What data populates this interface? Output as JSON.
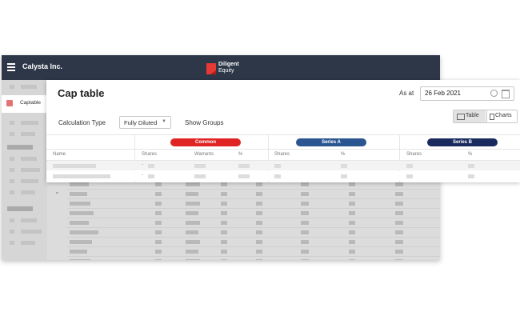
{
  "app": {
    "company": "Calysta Inc.",
    "brand_name": "Diligent",
    "brand_sub": "Equity",
    "brand_color": "#e53935",
    "titlebar_color": "#2d3748"
  },
  "sidebar": {
    "active_item": {
      "label": "Captable",
      "icon": "captable-icon"
    }
  },
  "page": {
    "title": "Cap table",
    "as_at_label": "As at",
    "as_at_date": "26 Feb 2021",
    "calc_type_label": "Calculation Type",
    "calc_type_value": "Fully Diluted",
    "show_groups_label": "Show Groups",
    "view_toggle": {
      "table": "Table",
      "charts": "Charts",
      "selected": "Table"
    }
  },
  "table": {
    "name_header": "Name",
    "groups": [
      {
        "label": "Common",
        "color": "#e02424",
        "columns": [
          "Shares",
          "Warrants",
          "%"
        ]
      },
      {
        "label": "Series A",
        "color": "#2b5591",
        "columns": [
          "Shares",
          "%"
        ]
      },
      {
        "label": "Series B",
        "color": "#1a2a5e",
        "columns": [
          "Shares",
          "%"
        ]
      }
    ]
  }
}
